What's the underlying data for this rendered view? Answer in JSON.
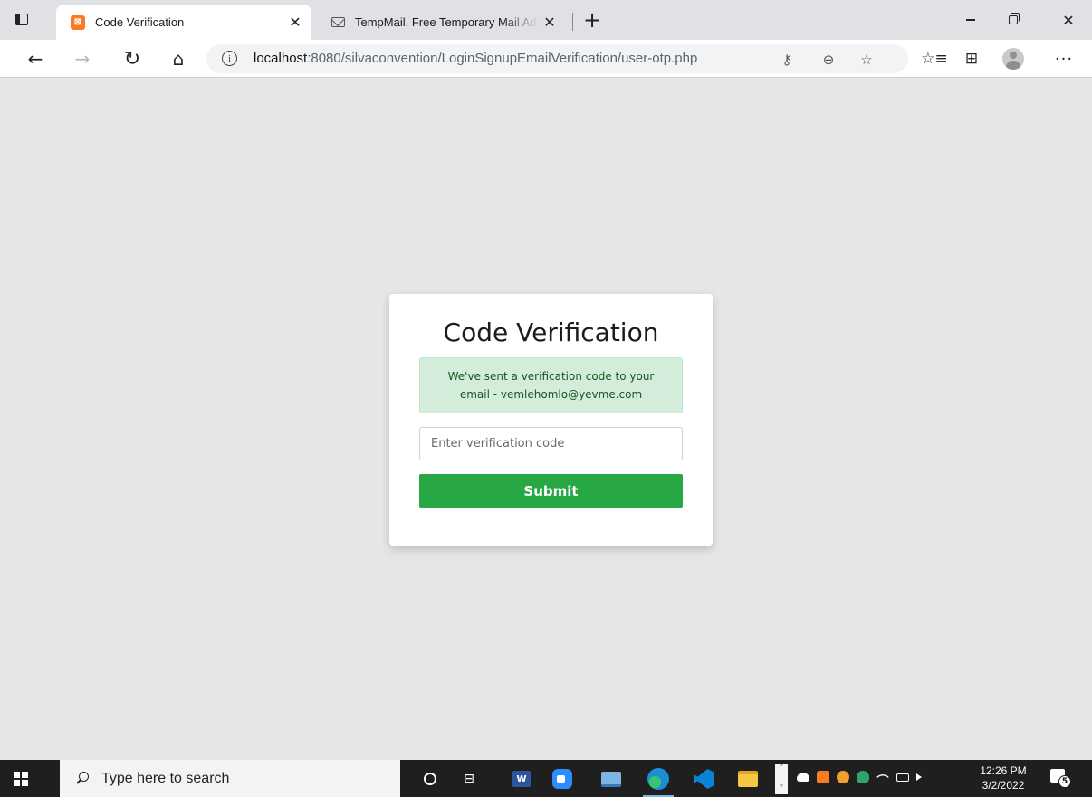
{
  "browser": {
    "tabs": [
      {
        "title": "Code Verification",
        "favicon": "xampp-icon",
        "active": true
      },
      {
        "title": "TempMail, Free Temporary Mail Address",
        "favicon": "mail-icon",
        "active": false
      }
    ],
    "url": {
      "host": "localhost",
      "path": ":8080/silvaconvention/LoginSignupEmailVerification/user-otp.php"
    },
    "close_glyph": "✕",
    "newtab_glyph": "+"
  },
  "page": {
    "title": "Code Verification",
    "alert_line1": "We've sent a verification code to your",
    "alert_line2": "email - vemlehomlo@yevme.com",
    "input_placeholder": "Enter verification code",
    "submit_label": "Submit",
    "colors": {
      "submit": "#28a745",
      "alert_bg": "#d4edda",
      "alert_text": "#155724"
    }
  },
  "taskbar": {
    "search_placeholder": "Type here to search",
    "time": "12:26 PM",
    "date": "3/2/2022",
    "notification_count": "5",
    "word_label": "W"
  }
}
